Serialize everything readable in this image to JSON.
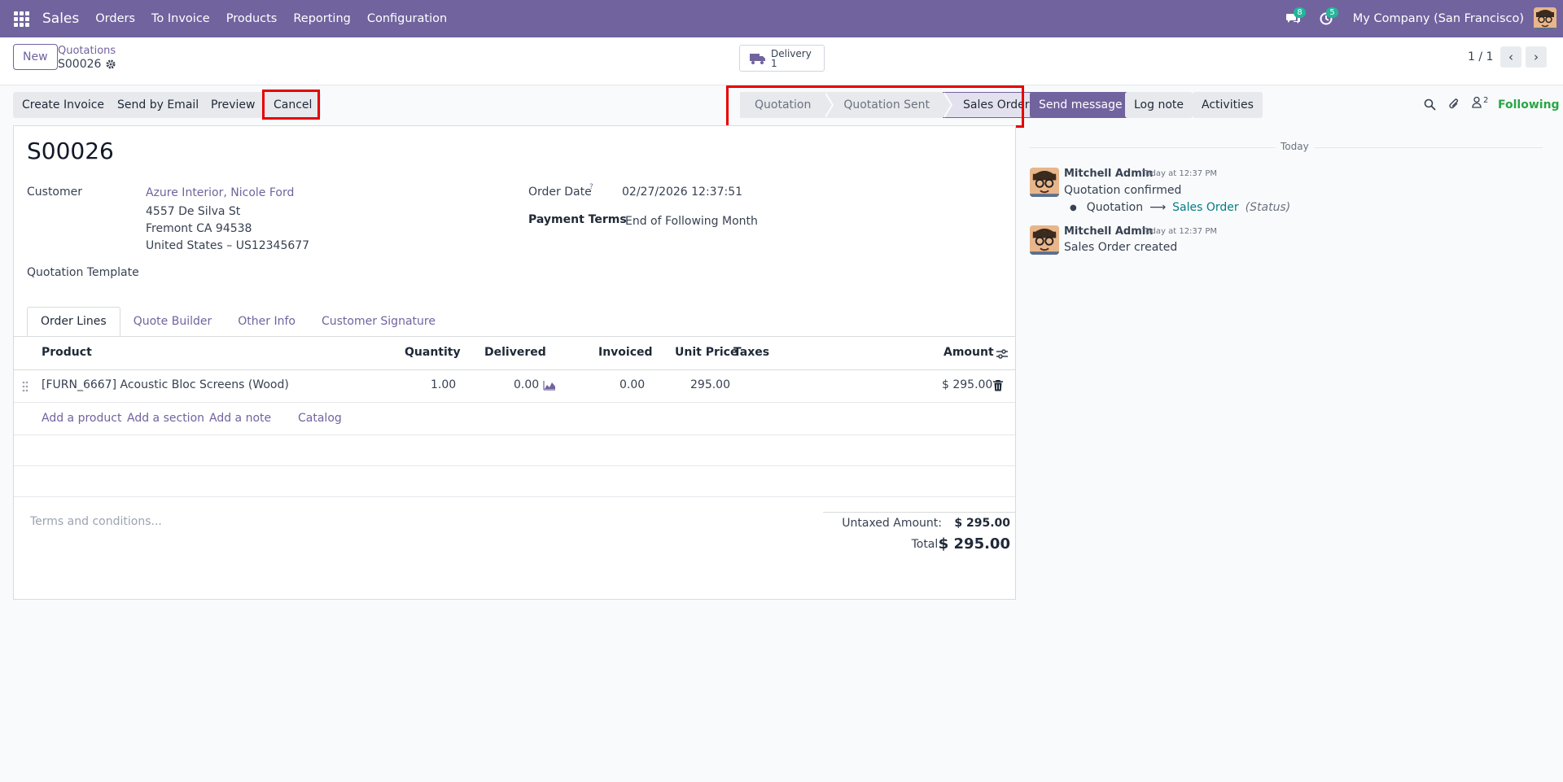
{
  "navbar": {
    "app_name": "Sales",
    "menus": [
      "Orders",
      "To Invoice",
      "Products",
      "Reporting",
      "Configuration"
    ],
    "messages_badge": "8",
    "activities_badge": "5",
    "company": "My Company (San Francisco)",
    "bg_color": "#71639e"
  },
  "control_panel": {
    "new_label": "New",
    "breadcrumb_parent": "Quotations",
    "record_name": "S00026",
    "smart_button": {
      "label": "Delivery",
      "count": "1"
    },
    "pager": "1 / 1"
  },
  "actions": {
    "create_invoice": "Create Invoice",
    "send_email": "Send by Email",
    "preview": "Preview",
    "cancel": "Cancel"
  },
  "statusbar": {
    "stages": [
      "Quotation",
      "Quotation Sent",
      "Sales Order"
    ],
    "active": "Sales Order"
  },
  "form": {
    "title": "S00026",
    "customer_label": "Customer",
    "customer_name": "Azure Interior, Nicole Ford",
    "address_line1": "4557 De Silva St",
    "address_line2": "Fremont CA 94538",
    "address_line3": "United States – US12345677",
    "template_label": "Quotation Template",
    "order_date_label": "Order Date",
    "order_date_help": "?",
    "order_date": "02/27/2026 12:37:51",
    "payment_terms_label": "Payment Terms",
    "payment_terms": "End of Following Month"
  },
  "tabs": [
    "Order Lines",
    "Quote Builder",
    "Other Info",
    "Customer Signature"
  ],
  "order_lines": {
    "columns": {
      "product": "Product",
      "quantity": "Quantity",
      "delivered": "Delivered",
      "invoiced": "Invoiced",
      "unit_price": "Unit Price",
      "taxes": "Taxes",
      "amount": "Amount"
    },
    "rows": [
      {
        "product": "[FURN_6667] Acoustic Bloc Screens (Wood)",
        "quantity": "1.00",
        "delivered": "0.00",
        "invoiced": "0.00",
        "unit_price": "295.00",
        "taxes": "",
        "amount": "$ 295.00"
      }
    ],
    "add_product": "Add a product",
    "add_section": "Add a section",
    "add_note": "Add a note",
    "catalog": "Catalog"
  },
  "terms_placeholder": "Terms and conditions...",
  "totals": {
    "untaxed_label": "Untaxed Amount:",
    "untaxed_value": "$ 295.00",
    "total_label": "Total:",
    "total_value": "$ 295.00"
  },
  "chatter": {
    "send_message": "Send message",
    "log_note": "Log note",
    "activities": "Activities",
    "followers_count": "2",
    "following": "Following",
    "date_separator": "Today",
    "messages": [
      {
        "author": "Mitchell Admin",
        "time": "Today at 12:37 PM",
        "body": "Quotation confirmed",
        "tracking_old": "Quotation",
        "tracking_new": "Sales Order",
        "tracking_field": "(Status)"
      },
      {
        "author": "Mitchell Admin",
        "time": "Today at 12:37 PM",
        "body": "Sales Order created"
      }
    ]
  }
}
